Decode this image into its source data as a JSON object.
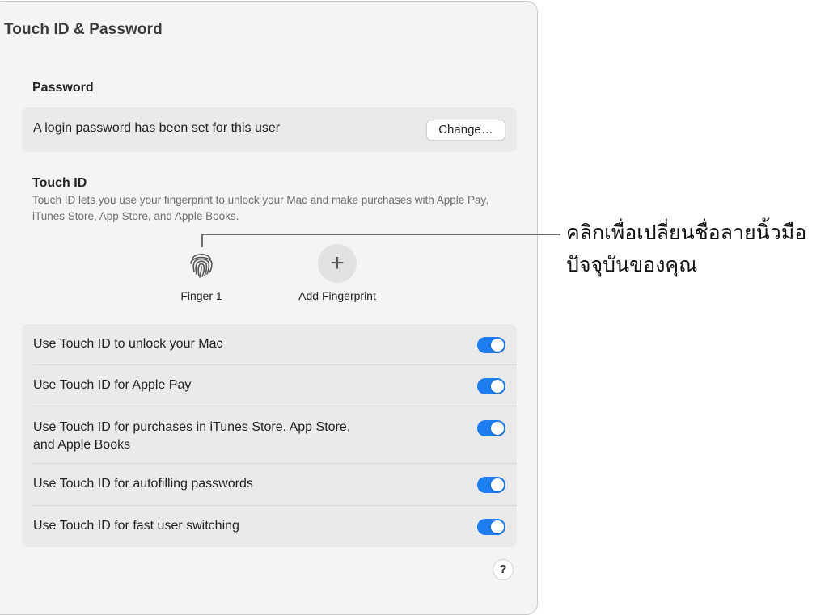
{
  "window": {
    "title": "Touch ID & Password"
  },
  "password": {
    "heading": "Password",
    "status_text": "A login password has been set for this user",
    "change_button": "Change…"
  },
  "touch_id": {
    "heading": "Touch ID",
    "description": "Touch ID lets you use your fingerprint to unlock your Mac and make purchases with Apple Pay, iTunes Store, App Store, and Apple Books.",
    "fingerprints": [
      {
        "label": "Finger 1",
        "icon": "fingerprint-icon"
      }
    ],
    "add_fingerprint": {
      "label": "Add Fingerprint",
      "icon": "plus-icon"
    }
  },
  "options": [
    {
      "label": "Use Touch ID to unlock your Mac",
      "enabled": true
    },
    {
      "label": "Use Touch ID for Apple Pay",
      "enabled": true
    },
    {
      "label": "Use Touch ID for purchases in iTunes Store, App Store,\nand Apple Books",
      "enabled": true
    },
    {
      "label": "Use Touch ID for autofilling passwords",
      "enabled": true
    },
    {
      "label": "Use Touch ID for fast user switching",
      "enabled": true
    }
  ],
  "help_button": "?",
  "callout": {
    "text": "คลิกเพื่อเปลี่ยนชื่อลายนิ้วมือปัจจุบันของคุณ"
  },
  "colors": {
    "toggle_on": "#1c7ef0",
    "panel_background": "#f5f4f4",
    "card_background": "#ebeaea"
  }
}
